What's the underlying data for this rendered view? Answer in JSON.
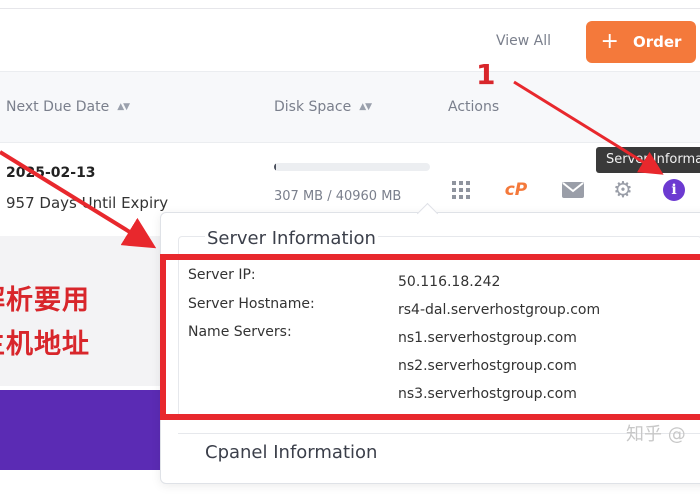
{
  "header": {
    "view_all": "View All",
    "order_label": "Order"
  },
  "table": {
    "columns": [
      "Next Due Date",
      "Disk Space",
      "Actions"
    ],
    "row": {
      "due_date": "2025-02-13",
      "due_days": "957 Days Until Expiry",
      "disk_text": "307 MB / 40960 MB",
      "disk_fraction": 0.0075,
      "tooltip": "Server Information"
    }
  },
  "server_info": {
    "title": "Server Information",
    "fields": [
      {
        "label": "Server IP:",
        "value": "50.116.18.242"
      },
      {
        "label": "Server Hostname:",
        "value": "rs4-dal.serverhostgroup.com"
      },
      {
        "label": "Name Servers:",
        "value": "ns1.serverhostgroup.com"
      },
      {
        "label": "",
        "value": "ns2.serverhostgroup.com"
      },
      {
        "label": "",
        "value": "ns3.serverhostgroup.com"
      }
    ]
  },
  "cpanel_info": {
    "title": "Cpanel Information"
  },
  "annotation": {
    "step_number": "1",
    "cn_line1": "解析要用",
    "cn_line2": "主机地址"
  },
  "watermark": "知乎 @",
  "colors": {
    "accent_orange": "#f4793b",
    "info_purple": "#6c3ad1",
    "annotation_red": "#e8282d"
  }
}
